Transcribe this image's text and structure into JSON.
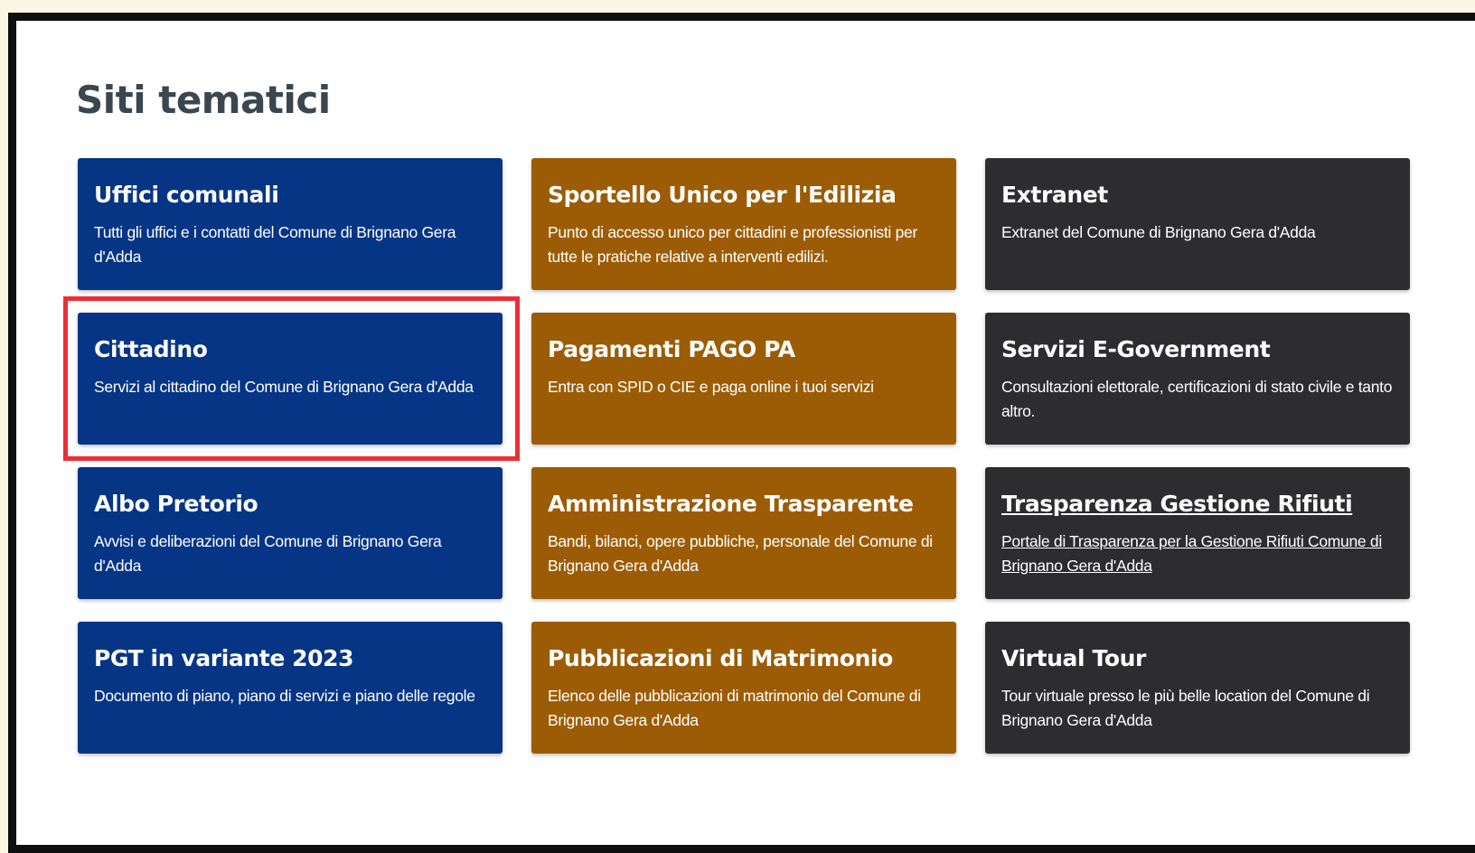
{
  "page": {
    "title": "Siti tematici"
  },
  "colors": {
    "blue": "#063585",
    "brown": "#9c5c05",
    "dark": "#2d2d2f",
    "highlight": "#ec2d36"
  },
  "cards": [
    {
      "title": "Uffici comunali",
      "desc": "Tutti gli uffici e i contatti del Comune di Brignano Gera d'Adda",
      "color": "blue"
    },
    {
      "title": "Sportello Unico per l'Edilizia",
      "desc": "Punto di accesso unico per cittadini e professionisti per tutte le pratiche relative a interventi edilizi.",
      "color": "brown"
    },
    {
      "title": "Extranet",
      "desc": "Extranet del Comune di Brignano Gera d'Adda",
      "color": "dark"
    },
    {
      "title": "Cittadino",
      "desc": "Servizi al cittadino del Comune di Brignano Gera d'Adda",
      "color": "blue",
      "highlighted": true
    },
    {
      "title": "Pagamenti PAGO PA",
      "desc": "Entra con SPID o CIE e paga online i tuoi servizi",
      "color": "brown"
    },
    {
      "title": "Servizi E-Government",
      "desc": "Consultazioni elettorale, certificazioni di stato civile e tanto altro.",
      "color": "dark"
    },
    {
      "title": "Albo Pretorio",
      "desc": "Avvisi e deliberazioni del Comune di Brignano Gera d'Adda",
      "color": "blue"
    },
    {
      "title": "Amministrazione Trasparente",
      "desc": "Bandi, bilanci, opere pubbliche, personale del Comune di Brignano Gera d'Adda",
      "color": "brown"
    },
    {
      "title": "Trasparenza Gestione Rifiuti",
      "desc": "Portale di Trasparenza per la Gestione Rifiuti Comune di Brignano Gera d'Adda",
      "color": "dark",
      "underlined": true
    },
    {
      "title": "PGT in variante 2023",
      "desc": "Documento di piano, piano di servizi e piano delle regole",
      "color": "blue"
    },
    {
      "title": "Pubblicazioni di Matrimonio",
      "desc": "Elenco delle pubblicazioni di matrimonio del Comune di Brignano Gera d'Adda",
      "color": "brown"
    },
    {
      "title": "Virtual Tour",
      "desc": "Tour virtuale presso le più belle location del Comune di Brignano Gera d'Adda",
      "color": "dark"
    }
  ]
}
